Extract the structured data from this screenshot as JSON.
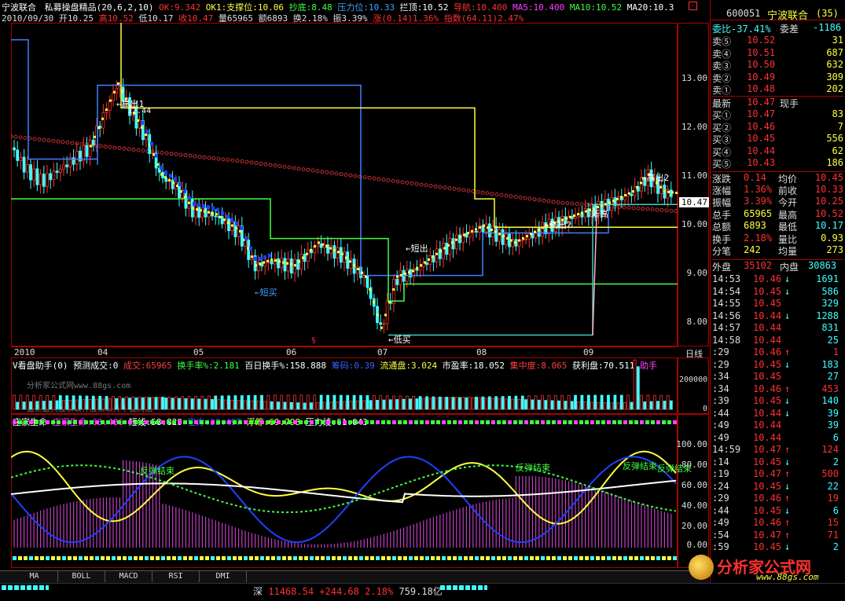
{
  "header": {
    "stock_name": "宁波联合",
    "indicator": "私募操盘精品(20,6,2,10)",
    "items": [
      {
        "label": "OK:9.342",
        "color": "#ff3030"
      },
      {
        "label": "OK1:支撑位:10.06",
        "color": "#ffff40"
      },
      {
        "label": "抄底:8.48",
        "color": "#40ff40"
      },
      {
        "label": "压力位:10.33",
        "color": "#40a0ff"
      },
      {
        "label": "拦顶:10.52",
        "color": "#ffffff"
      },
      {
        "label": "导航:10.400",
        "color": "#ff3030"
      },
      {
        "label": "MA5:10.400",
        "color": "#ff40ff"
      },
      {
        "label": "MA10:10.52",
        "color": "#40ff40"
      },
      {
        "label": "MA20:10.3",
        "color": "#ffffff"
      }
    ],
    "line2": {
      "date": "2010/09/30",
      "open": "开10.25",
      "high": "高10.52",
      "low": "低10.17",
      "close": "收10.47",
      "vol": "量65965",
      "amount": "额6893",
      "turnover": "换2.18%",
      "amplitude": "振3.39%",
      "change": "涨(0.14)1.36%",
      "index": "指数(64.11)2.47%"
    }
  },
  "price_chart": {
    "scale_labels": [
      "13.00",
      "12.00",
      "11.00",
      "10.00",
      "9.00",
      "8.00"
    ],
    "current_price": "10.47",
    "annotations": {
      "high1": "←高出1",
      "high1_val": "12.44",
      "high2": "←高出2",
      "high3": "←高出2",
      "short_out": "←短出",
      "short_buy": "←短买",
      "low_buy": "←低买",
      "new_high": "新高"
    },
    "months": [
      "2010",
      "04",
      "05",
      "06",
      "07",
      "08",
      "09"
    ],
    "period": "日线"
  },
  "chart_data": [
    {
      "type": "line",
      "title": "宁波联合 日线",
      "x": [
        "2010-03",
        "2010-04",
        "2010-05",
        "2010-06",
        "2010-07",
        "2010-08",
        "2010-09"
      ],
      "series": [
        {
          "name": "close",
          "values": [
            11.2,
            12.2,
            10.2,
            9.1,
            8.6,
            9.8,
            10.47
          ]
        }
      ],
      "ylim": [
        7.8,
        13.5
      ]
    },
    {
      "type": "bar",
      "title": "V看盘助手",
      "series": [
        {
          "name": "成交",
          "values": [
            65965
          ]
        }
      ],
      "ylim": [
        0,
        260000
      ]
    },
    {
      "type": "line",
      "title": "庄家生命",
      "series": [
        {
          "name": "庄家生命",
          "values": [
            63.486
          ]
        },
        {
          "name": "短线",
          "values": [
            58.829
          ]
        },
        {
          "name": "空方",
          "values": [
            32.497
          ]
        },
        {
          "name": "浮筹",
          "values": [
            69.798
          ]
        },
        {
          "name": "压力线",
          "values": [
            61.043
          ]
        }
      ],
      "ylim": [
        0,
        100
      ]
    }
  ],
  "volume_panel": {
    "title": "V看盘助手(0)",
    "items": [
      {
        "label": "预测成交:0",
        "color": "#ffffff"
      },
      {
        "label": "成交:65965",
        "color": "#ff4040"
      },
      {
        "label": "换手率%:2.181",
        "color": "#40ff40"
      },
      {
        "label": "百日换手%:158.888",
        "color": "#ffffff"
      },
      {
        "label": "筹码:0.39",
        "color": "#4060ff"
      },
      {
        "label": "流通盘:3.024",
        "color": "#ffff40"
      },
      {
        "label": "市盈率:18.052",
        "color": "#ffffff"
      },
      {
        "label": "集中度:8.065",
        "color": "#ff4040"
      },
      {
        "label": "获利盘:70.511",
        "color": "#ffffff"
      },
      {
        "label": "助手",
        "color": "#ff40ff"
      }
    ],
    "watermark": "分析家公式网www.88gs.com",
    "watermark2": "最新最大股票软件股票软件下载网站",
    "scale_labels": [
      "200000",
      "0"
    ]
  },
  "life_panel": {
    "title": "庄家生命",
    "items": [
      {
        "label": "庄家生命:63.486",
        "color": "#ff40ff"
      },
      {
        "label": "短线:58.829",
        "color": "#ffffff"
      },
      {
        "label": "空方:32.497",
        "color": "#4060ff"
      },
      {
        "label": "浮筹:69.798",
        "color": "#ffff40"
      },
      {
        "label": "压力线:61.043",
        "color": "#ffffff"
      }
    ],
    "annotations": [
      "反弹结束",
      "反弹结束",
      "反弹结束",
      "反弹结束"
    ],
    "scale_labels": [
      "100.00",
      "80.00",
      "60.00",
      "40.00",
      "20.00",
      "0.00"
    ]
  },
  "bottom_tabs": [
    "MA",
    "BOLL",
    "MACD",
    "RSI",
    "DMI"
  ],
  "status_bar": {
    "index_name": "深",
    "value": "11468.54",
    "change": "+244.68",
    "pct": "2.18%",
    "amount": "759.18亿"
  },
  "quote_panel": {
    "code": "600051",
    "name": "宁波联合",
    "num": "(35)",
    "webi": "委比-37.41%",
    "weicha_label": "委差",
    "weicha": "-1186",
    "sells": [
      {
        "label": "卖⑤",
        "price": "10.52",
        "vol": "31"
      },
      {
        "label": "卖④",
        "price": "10.51",
        "vol": "687"
      },
      {
        "label": "卖③",
        "price": "10.50",
        "vol": "632"
      },
      {
        "label": "卖②",
        "price": "10.49",
        "vol": "309"
      },
      {
        "label": "卖①",
        "price": "10.48",
        "vol": "202"
      }
    ],
    "latest_label": "最新",
    "latest": "10.47",
    "latest_tag": "现手",
    "buys": [
      {
        "label": "买①",
        "price": "10.47",
        "vol": "83"
      },
      {
        "label": "买②",
        "price": "10.46",
        "vol": "7"
      },
      {
        "label": "买③",
        "price": "10.45",
        "vol": "556"
      },
      {
        "label": "买④",
        "price": "10.44",
        "vol": "62"
      },
      {
        "label": "买⑤",
        "price": "10.43",
        "vol": "186"
      }
    ],
    "stats": [
      {
        "l1": "涨跌",
        "v1": "0.14",
        "l2": "均价",
        "v2": "10.45"
      },
      {
        "l1": "涨幅",
        "v1": "1.36%",
        "l2": "前收",
        "v2": "10.33"
      },
      {
        "l1": "振幅",
        "v1": "3.39%",
        "l2": "今开",
        "v2": "10.25"
      },
      {
        "l1": "总手",
        "v1": "65965",
        "l2": "最高",
        "v2": "10.52"
      },
      {
        "l1": "总额",
        "v1": "6893",
        "l2": "最低",
        "v2": "10.17"
      },
      {
        "l1": "换手",
        "v1": "2.18%",
        "l2": "量比",
        "v2": "0.93"
      },
      {
        "l1": "分笔",
        "v1": "242",
        "l2": "均量",
        "v2": "273"
      }
    ],
    "outer_label": "外盘",
    "outer": "35102",
    "inner_label": "内盘",
    "inner": "30863",
    "ticks": [
      {
        "t": "14:53",
        "p": "10.46",
        "d": "↓",
        "v": "1691"
      },
      {
        "t": "14:54",
        "p": "10.45",
        "d": "↓",
        "v": "586"
      },
      {
        "t": "14:55",
        "p": "10.45",
        "d": "",
        "v": "329"
      },
      {
        "t": "14:56",
        "p": "10.44",
        "d": "↓",
        "v": "1288"
      },
      {
        "t": "14:57",
        "p": "10.44",
        "d": "",
        "v": "831"
      },
      {
        "t": "14:58",
        "p": "10.44",
        "d": "",
        "v": "25"
      },
      {
        "t": ":29",
        "p": "10.46",
        "d": "↑",
        "v": "1"
      },
      {
        "t": ":29",
        "p": "10.45",
        "d": "↓",
        "v": "183"
      },
      {
        "t": ":34",
        "p": "10.45",
        "d": "",
        "v": "27"
      },
      {
        "t": ":34",
        "p": "10.46",
        "d": "↑",
        "v": "453"
      },
      {
        "t": ":39",
        "p": "10.45",
        "d": "↓",
        "v": "140"
      },
      {
        "t": ":44",
        "p": "10.44",
        "d": "↓",
        "v": "39"
      },
      {
        "t": ":49",
        "p": "10.44",
        "d": "",
        "v": "39"
      },
      {
        "t": ":49",
        "p": "10.44",
        "d": "",
        "v": "6"
      },
      {
        "t": "14:59",
        "p": "10.47",
        "d": "↑",
        "v": "124"
      },
      {
        "t": ":14",
        "p": "10.45",
        "d": "↓",
        "v": "2"
      },
      {
        "t": ":19",
        "p": "10.47",
        "d": "↑",
        "v": "500"
      },
      {
        "t": ":24",
        "p": "10.45",
        "d": "↓",
        "v": "22"
      },
      {
        "t": ":29",
        "p": "10.46",
        "d": "↑",
        "v": "19"
      },
      {
        "t": ":44",
        "p": "10.45",
        "d": "↓",
        "v": "6"
      },
      {
        "t": ":49",
        "p": "10.46",
        "d": "↑",
        "v": "15"
      },
      {
        "t": ":54",
        "p": "10.47",
        "d": "↑",
        "v": "71"
      },
      {
        "t": ":59",
        "p": "10.45",
        "d": "↓",
        "v": "2"
      }
    ],
    "logo": "分析家公式网",
    "logo_url": "www.88gs.com"
  },
  "colors": {
    "up": "#ff3030",
    "down": "#40ffff",
    "grid": "#a00000",
    "yellow": "#ffff40",
    "green": "#40ff40"
  }
}
